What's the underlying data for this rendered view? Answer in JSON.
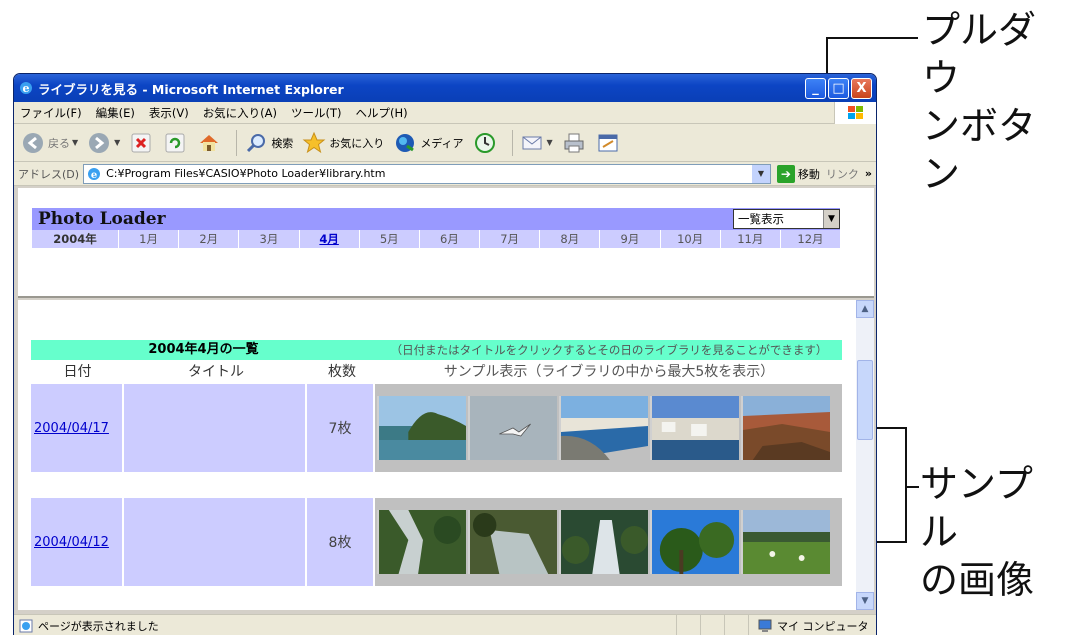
{
  "window": {
    "title": "ライブラリを見る - Microsoft Internet Explorer",
    "minimize": "_",
    "maximize": "□",
    "close": "X"
  },
  "menu": [
    "ファイル(F)",
    "編集(E)",
    "表示(V)",
    "お気に入り(A)",
    "ツール(T)",
    "ヘルプ(H)"
  ],
  "toolbar": {
    "back": "戻る",
    "search": "検索",
    "favorites": "お気に入り",
    "media": "メディア"
  },
  "address": {
    "label": "アドレス(D)",
    "url": "C:¥Program Files¥CASIO¥Photo Loader¥library.htm",
    "go": "移動",
    "links": "リンク",
    "more": "»"
  },
  "photo_loader": {
    "title": "Photo Loader",
    "view_select": "一覧表示",
    "year": "2004年",
    "months": [
      "1月",
      "2月",
      "3月",
      "4月",
      "5月",
      "6月",
      "7月",
      "8月",
      "9月",
      "10月",
      "11月",
      "12月"
    ],
    "active_month": "4月"
  },
  "list": {
    "title": "2004年4月の一覧",
    "note": "（日付またはタイトルをクリックするとその日のライブラリを見ることができます）",
    "columns": {
      "date": "日付",
      "title": "タイトル",
      "count": "枚数",
      "sample": "サンプル表示（ライブラリの中から最大5枚を表示）"
    },
    "rows": [
      {
        "date": "2004/04/17",
        "title": "",
        "count": "7枚"
      },
      {
        "date": "2004/04/12",
        "title": "",
        "count": "8枚"
      }
    ]
  },
  "status": {
    "text": "ページが表示されました",
    "zone": "マイ コンピュータ"
  },
  "callouts": {
    "pulldown": "プルダウ\nンボタン",
    "sample": "サンプル\nの画像"
  },
  "colors": {
    "header_blue": "#9999ff",
    "month_bar": "#ccccff",
    "list_header": "#66ffcc",
    "link": "#0000cc"
  }
}
